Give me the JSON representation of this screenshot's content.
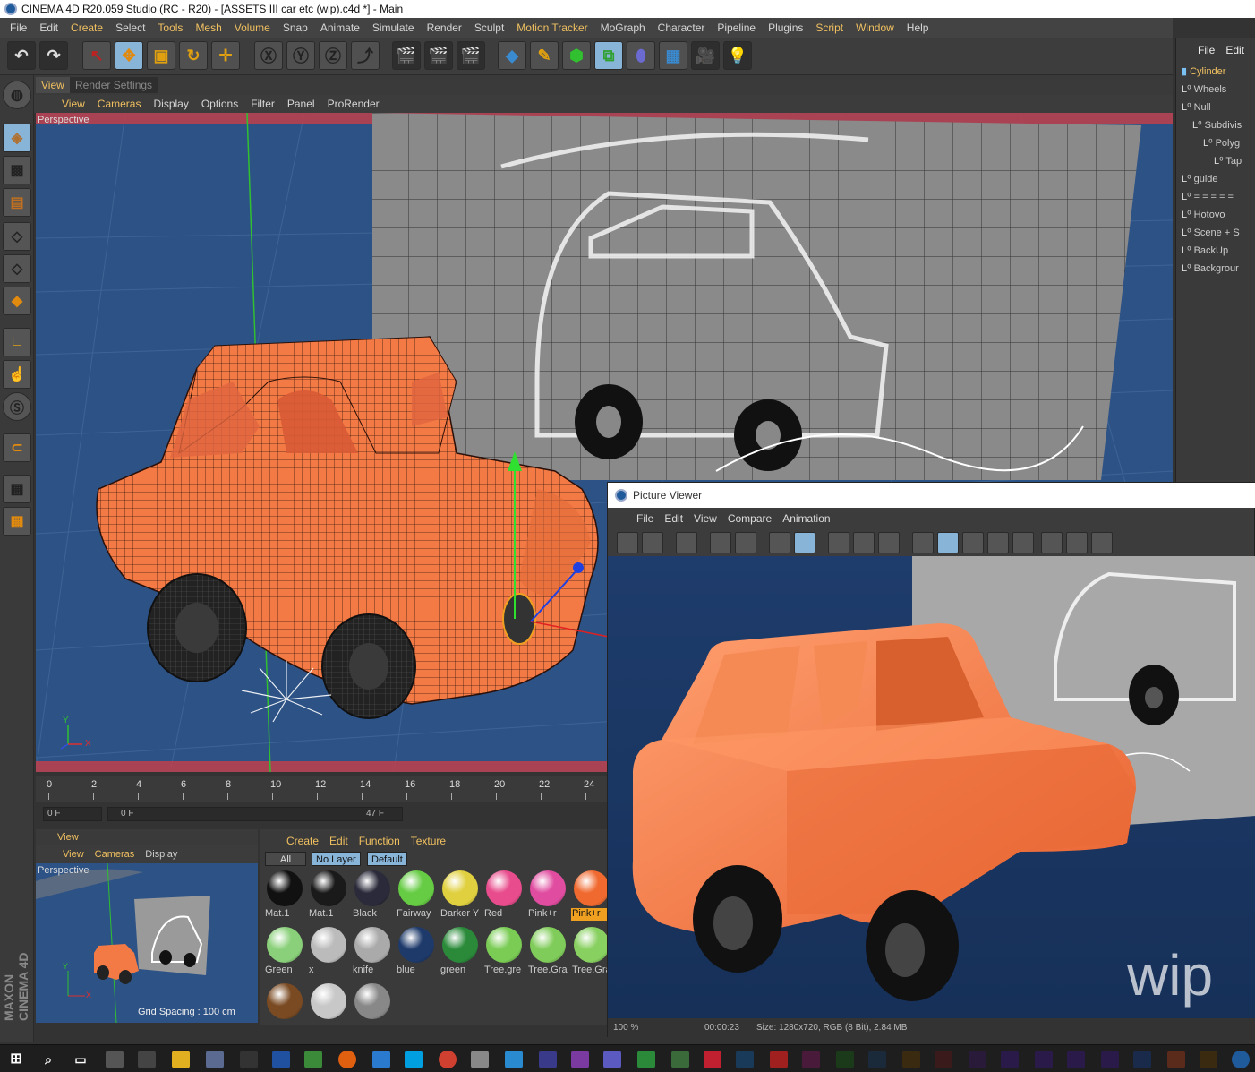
{
  "window": {
    "title": "CINEMA 4D R20.059 Studio (RC - R20) - [ASSETS III car etc (wip).c4d *] - Main"
  },
  "menubar": [
    "File",
    "Edit",
    "Create",
    "Select",
    "Tools",
    "Mesh",
    "Volume",
    "Snap",
    "Animate",
    "Simulate",
    "Render",
    "Sculpt",
    "Motion Tracker",
    "MoGraph",
    "Character",
    "Pipeline",
    "Plugins",
    "Script",
    "Window",
    "Help"
  ],
  "viewport_tabs": {
    "view": "View",
    "render_settings": "Render Settings"
  },
  "viewport_menu": [
    "View",
    "Cameras",
    "Display",
    "Options",
    "Filter",
    "Panel",
    "ProRender"
  ],
  "viewport": {
    "label": "Perspective",
    "axis_y": "Y",
    "axis_x": "X"
  },
  "timeline": {
    "ticks": [
      "0",
      "2",
      "4",
      "6",
      "8",
      "10",
      "12",
      "14",
      "16",
      "18",
      "20",
      "22",
      "24"
    ],
    "current_frame": "0 F",
    "range_start": "0 F",
    "range_end": "47 F"
  },
  "small_viewport": {
    "tab": "View",
    "menu": [
      "View",
      "Cameras",
      "Display"
    ],
    "label": "Perspective",
    "grid_spacing": "Grid Spacing : 100 cm",
    "axis_y": "Y",
    "axis_x": "X"
  },
  "materials": {
    "menu": [
      "Create",
      "Edit",
      "Function",
      "Texture"
    ],
    "filters": [
      "All",
      "No Layer",
      "Default"
    ],
    "items": [
      {
        "label": "Mat.1",
        "color": "#111111"
      },
      {
        "label": "Mat.1",
        "color": "#1a1a1a"
      },
      {
        "label": "Black",
        "color": "#2a2a3a"
      },
      {
        "label": "Fairway",
        "color": "#66cc44"
      },
      {
        "label": "Darker Y",
        "color": "#e0d040"
      },
      {
        "label": "Red",
        "color": "#e84c8c"
      },
      {
        "label": "Pink+r",
        "color": "#e04ca0"
      },
      {
        "label": "Pink+r",
        "color": "#f06a30"
      },
      {
        "label": "Green",
        "color": "#8ad07a"
      },
      {
        "label": "x",
        "color": "#bbbbbb"
      },
      {
        "label": "knife",
        "color": "#aaaaaa"
      },
      {
        "label": "blue",
        "color": "#1e3a6a"
      },
      {
        "label": "green",
        "color": "#2a8a3a"
      },
      {
        "label": "Tree.gre",
        "color": "#7acc55"
      },
      {
        "label": "Tree.Gra",
        "color": "#80cc5a"
      },
      {
        "label": "Tree.Gra",
        "color": "#88d060"
      },
      {
        "label": "",
        "color": "#7a4a22"
      },
      {
        "label": "",
        "color": "#c8c8c8"
      },
      {
        "label": "",
        "color": "#888888"
      }
    ]
  },
  "objects": {
    "menu": [
      "File",
      "Edit"
    ],
    "items": [
      {
        "label": "Cylinder",
        "indent": 0,
        "hl": true
      },
      {
        "label": "Wheels",
        "indent": 0,
        "hl": false
      },
      {
        "label": "Null",
        "indent": 0,
        "hl": false
      },
      {
        "label": "Subdivis",
        "indent": 1,
        "hl": false
      },
      {
        "label": "Polyg",
        "indent": 2,
        "hl": false
      },
      {
        "label": "Tap",
        "indent": 3,
        "hl": false
      },
      {
        "label": "guide",
        "indent": 0,
        "hl": false
      },
      {
        "label": "= = = = =",
        "indent": 0,
        "hl": false
      },
      {
        "label": "Hotovo",
        "indent": 0,
        "hl": false
      },
      {
        "label": "Scene + S",
        "indent": 0,
        "hl": false
      },
      {
        "label": "BackUp",
        "indent": 0,
        "hl": false
      },
      {
        "label": "Backgrour",
        "indent": 0,
        "hl": false
      }
    ]
  },
  "picture_viewer": {
    "title": "Picture Viewer",
    "menu": [
      "File",
      "Edit",
      "View",
      "Compare",
      "Animation"
    ],
    "watermark": "wip",
    "zoom": "100 %",
    "time": "00:00:23",
    "size_info": "Size: 1280x720, RGB (8 Bit), 2.84 MB"
  },
  "branding": {
    "maxon": "MAXON CINEMA 4D"
  },
  "colors": {
    "accent": "#f0c060",
    "active_button": "#88b4d8",
    "car_orange": "#f47a45",
    "bg_blue": "#2c4f7c"
  }
}
